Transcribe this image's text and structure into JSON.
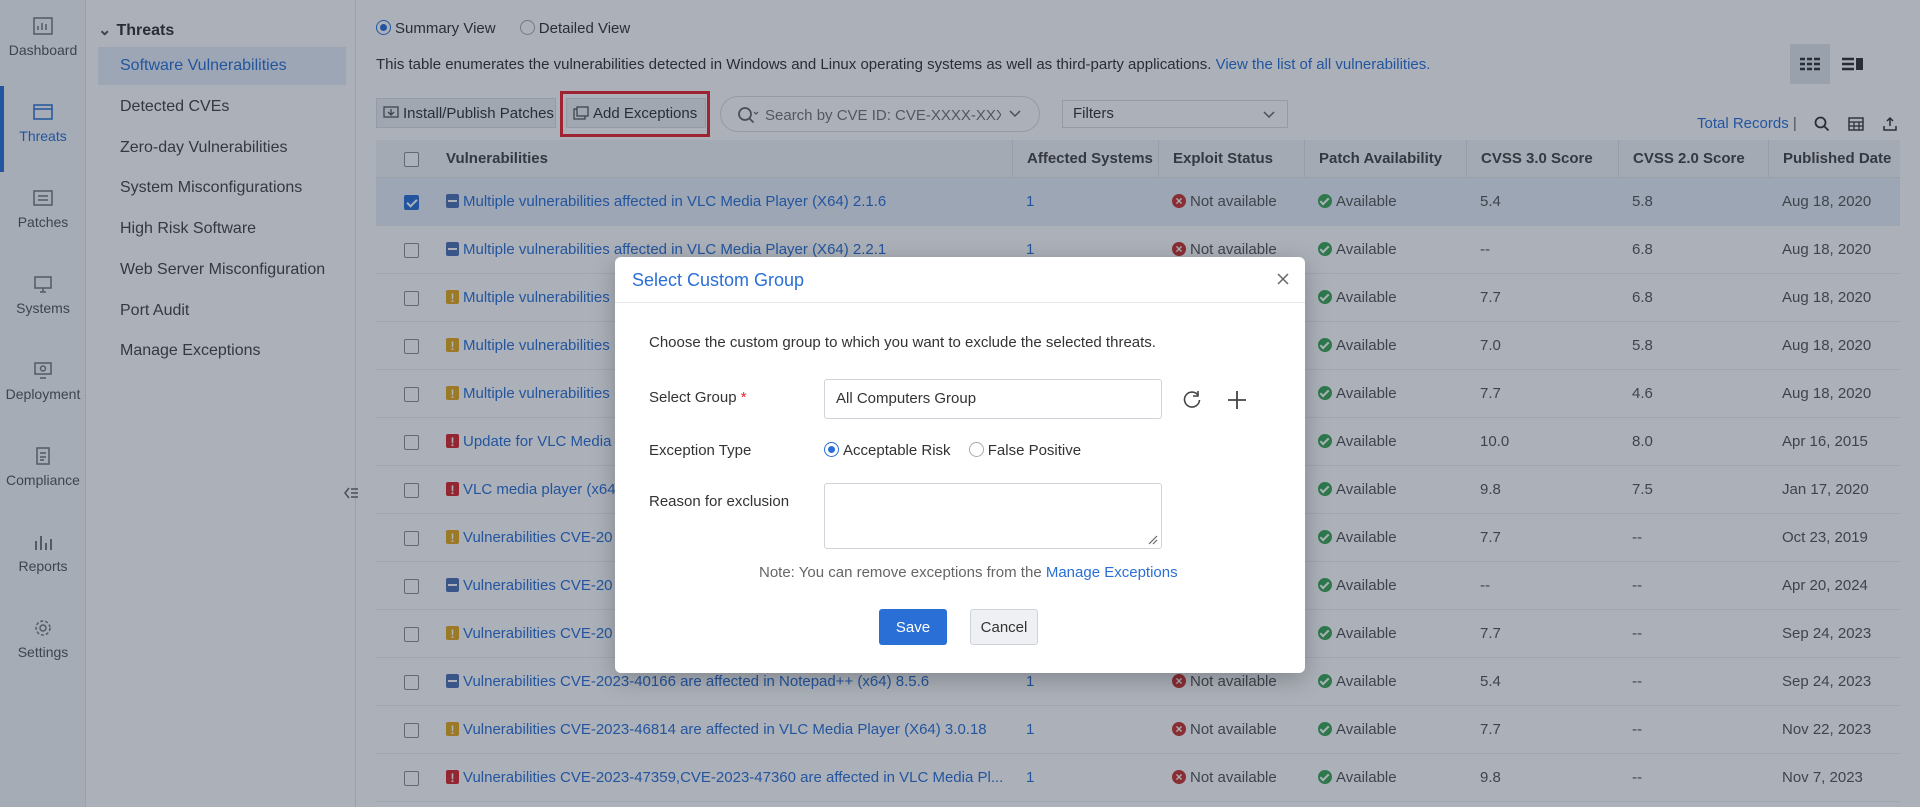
{
  "rail": [
    {
      "label": "Dashboard",
      "icon": "dashboard-icon"
    },
    {
      "label": "Threats",
      "icon": "threats-icon",
      "active": true
    },
    {
      "label": "Patches",
      "icon": "patches-icon"
    },
    {
      "label": "Systems",
      "icon": "systems-icon"
    },
    {
      "label": "Deployment",
      "icon": "deployment-icon"
    },
    {
      "label": "Compliance",
      "icon": "compliance-icon"
    },
    {
      "label": "Reports",
      "icon": "reports-icon"
    },
    {
      "label": "Settings",
      "icon": "settings-icon"
    }
  ],
  "subnav": {
    "heading": "Threats",
    "items": [
      {
        "label": "Software Vulnerabilities",
        "active": true
      },
      {
        "label": "Detected CVEs"
      },
      {
        "label": "Zero-day Vulnerabilities"
      },
      {
        "label": "System Misconfigurations"
      },
      {
        "label": "High Risk Software"
      },
      {
        "label": "Web Server Misconfiguration"
      },
      {
        "label": "Port Audit"
      },
      {
        "label": "Manage Exceptions"
      }
    ]
  },
  "views": {
    "summary": "Summary View",
    "detailed": "Detailed View",
    "selected": "summary"
  },
  "description": {
    "text": "This table enumerates the vulnerabilities detected in Windows and Linux operating systems as well as third-party applications.",
    "link": "View the list of all vulnerabilities."
  },
  "toolbar": {
    "install_label": "Install/Publish Patches",
    "add_exceptions_label": "Add Exceptions",
    "search_placeholder": "Search by CVE ID: CVE-XXXX-XXXX",
    "filters_label": "Filters",
    "total_records": "Total Records",
    "total_sep": "|"
  },
  "table": {
    "columns": [
      "Vulnerabilities",
      "Affected Systems",
      "Exploit Status",
      "Patch Availability",
      "CVSS 3.0 Score",
      "CVSS 2.0 Score",
      "Published Date"
    ],
    "rows": [
      {
        "checked": true,
        "severity": "medium",
        "name": "Multiple vulnerabilities affected in VLC Media Player (X64) 2.1.6",
        "affected": "1",
        "exploit": "Not available",
        "patch": "Available",
        "cvss3": "5.4",
        "cvss2": "5.8",
        "published": "Aug 18, 2020"
      },
      {
        "checked": false,
        "severity": "medium",
        "name": "Multiple vulnerabilities affected in VLC Media Player (X64) 2.2.1",
        "affected": "1",
        "exploit": "Not available",
        "patch": "Available",
        "cvss3": "--",
        "cvss2": "6.8",
        "published": "Aug 18, 2020"
      },
      {
        "checked": false,
        "severity": "high",
        "name": "Multiple vulnerabilities",
        "affected": "",
        "exploit": "",
        "patch": "Available",
        "cvss3": "7.7",
        "cvss2": "6.8",
        "published": "Aug 18, 2020"
      },
      {
        "checked": false,
        "severity": "high",
        "name": "Multiple vulnerabilities",
        "affected": "",
        "exploit": "",
        "patch": "Available",
        "cvss3": "7.0",
        "cvss2": "5.8",
        "published": "Aug 18, 2020"
      },
      {
        "checked": false,
        "severity": "high",
        "name": "Multiple vulnerabilities",
        "affected": "",
        "exploit": "",
        "patch": "Available",
        "cvss3": "7.7",
        "cvss2": "4.6",
        "published": "Aug 18, 2020"
      },
      {
        "checked": false,
        "severity": "critical",
        "name": "Update for VLC Media",
        "affected": "",
        "exploit": "",
        "patch": "Available",
        "cvss3": "10.0",
        "cvss2": "8.0",
        "published": "Apr 16, 2015"
      },
      {
        "checked": false,
        "severity": "critical",
        "name": "VLC media player (x64)",
        "affected": "",
        "exploit": "",
        "patch": "Available",
        "cvss3": "9.8",
        "cvss2": "7.5",
        "published": "Jan 17, 2020"
      },
      {
        "checked": false,
        "severity": "high",
        "name": "Vulnerabilities CVE-20",
        "affected": "",
        "exploit": "",
        "patch": "Available",
        "cvss3": "7.7",
        "cvss2": "--",
        "published": "Oct 23, 2019"
      },
      {
        "checked": false,
        "severity": "medium",
        "name": "Vulnerabilities CVE-20",
        "affected": "",
        "exploit": "",
        "patch": "Available",
        "cvss3": "--",
        "cvss2": "--",
        "published": "Apr 20, 2024"
      },
      {
        "checked": false,
        "severity": "high",
        "name": "Vulnerabilities CVE-20",
        "affected": "",
        "exploit": "",
        "patch": "Available",
        "cvss3": "7.7",
        "cvss2": "--",
        "published": "Sep 24, 2023"
      },
      {
        "checked": false,
        "severity": "medium",
        "name": "Vulnerabilities CVE-2023-40166 are affected in Notepad++ (x64) 8.5.6",
        "affected": "1",
        "exploit": "Not available",
        "patch": "Available",
        "cvss3": "5.4",
        "cvss2": "--",
        "published": "Sep 24, 2023"
      },
      {
        "checked": false,
        "severity": "high",
        "name": "Vulnerabilities CVE-2023-46814 are affected in VLC Media Player (X64) 3.0.18",
        "affected": "1",
        "exploit": "Not available",
        "patch": "Available",
        "cvss3": "7.7",
        "cvss2": "--",
        "published": "Nov 22, 2023"
      },
      {
        "checked": false,
        "severity": "critical",
        "name": "Vulnerabilities CVE-2023-47359,CVE-2023-47360 are affected in VLC Media Pl...",
        "affected": "1",
        "exploit": "Not available",
        "patch": "Available",
        "cvss3": "9.8",
        "cvss2": "--",
        "published": "Nov 7, 2023"
      }
    ]
  },
  "modal": {
    "title": "Select Custom Group",
    "intro": "Choose the custom group to which you want to exclude the selected threats.",
    "group_label": "Select Group",
    "required_mark": "*",
    "group_value": "All Computers Group",
    "exception_type_label": "Exception Type",
    "exception_options": [
      "Acceptable Risk",
      "False Positive"
    ],
    "exception_selected": "Acceptable Risk",
    "reason_label": "Reason for exclusion",
    "reason_value": "",
    "note_text": "Note: You can remove exceptions from the",
    "note_link": "Manage Exceptions",
    "save_label": "Save",
    "cancel_label": "Cancel"
  },
  "colors": {
    "accent": "#2a6fd6",
    "highlight": "#e8232a",
    "ok": "#3aa655",
    "na": "#c8322e",
    "sev_high": "#e7a817",
    "sev_critical": "#d9262c",
    "sev_medium": "#4e6fb3"
  }
}
